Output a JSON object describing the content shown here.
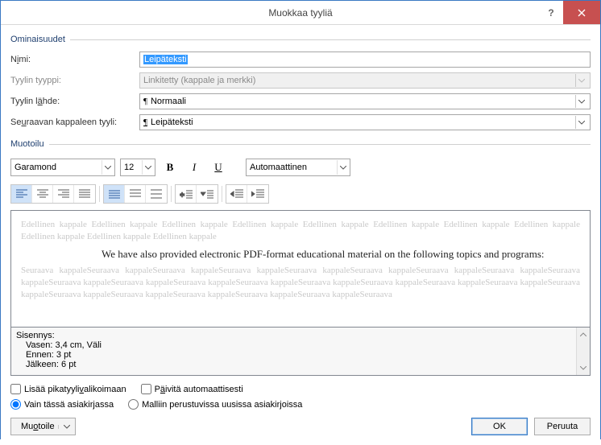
{
  "titlebar": {
    "title": "Muokkaa tyyliä"
  },
  "group_properties": "Ominaisuudet",
  "fields": {
    "name_label_pre": "N",
    "name_label_u": "i",
    "name_label_post": "mi:",
    "name_value": "Leipäteksti",
    "type_label": "Tyylin tyyppi:",
    "type_value": "Linkitetty (kappale ja merkki)",
    "basedon_pre": "Tyylin l",
    "basedon_u": "ä",
    "basedon_post": "hde:",
    "basedon_value": "Normaali",
    "next_pre": "Se",
    "next_u": "u",
    "next_post": "raavan kappaleen tyyli:",
    "next_value": "Leipäteksti"
  },
  "group_format": "Muotoilu",
  "toolbar": {
    "font": "Garamond",
    "size": "12",
    "color_label": "Automaattinen"
  },
  "preview": {
    "prev_para": "Edellinen kappale Edellinen kappale Edellinen kappale Edellinen kappale Edellinen kappale Edellinen kappale Edellinen kappale Edellinen kappale Edellinen kappale Edellinen kappale Edellinen kappale",
    "sample": "We have also provided electronic PDF-format educational material on the following topics and programs:",
    "next_para": "Seuraava kappaleSeuraava kappaleSeuraava kappaleSeuraava kappaleSeuraava kappaleSeuraava kappaleSeuraava kappaleSeuraava kappaleSeuraava kappaleSeuraava kappaleSeuraava kappaleSeuraava kappaleSeuraava kappaleSeuraava kappaleSeuraava kappaleSeuraava kappaleSeuraava kappaleSeuraava kappaleSeuraava kappaleSeuraava kappaleSeuraava kappaleSeuraava kappaleSeuraava kappaleSeuraava"
  },
  "description": {
    "l1": "Sisennys:",
    "l2": "Vasen:  3,4 cm, Väli",
    "l3": "Ennen:  3 pt",
    "l4": "Jälkeen:  6 pt"
  },
  "options": {
    "add_quick_pre": "Lisää pikatyyli",
    "add_quick_u": "v",
    "add_quick_post": "alikoimaan",
    "auto_update_pre": "P",
    "auto_update_u": "ä",
    "auto_update_post": "ivitä automaattisesti",
    "this_doc": "Vain tässä asiakirjassa",
    "template": "Malliin perustuvissa uusissa asiakirjoissa"
  },
  "buttons": {
    "format_pre": "Mu",
    "format_u": "o",
    "format_post": "toile",
    "ok": "OK",
    "cancel": "Peruuta"
  }
}
